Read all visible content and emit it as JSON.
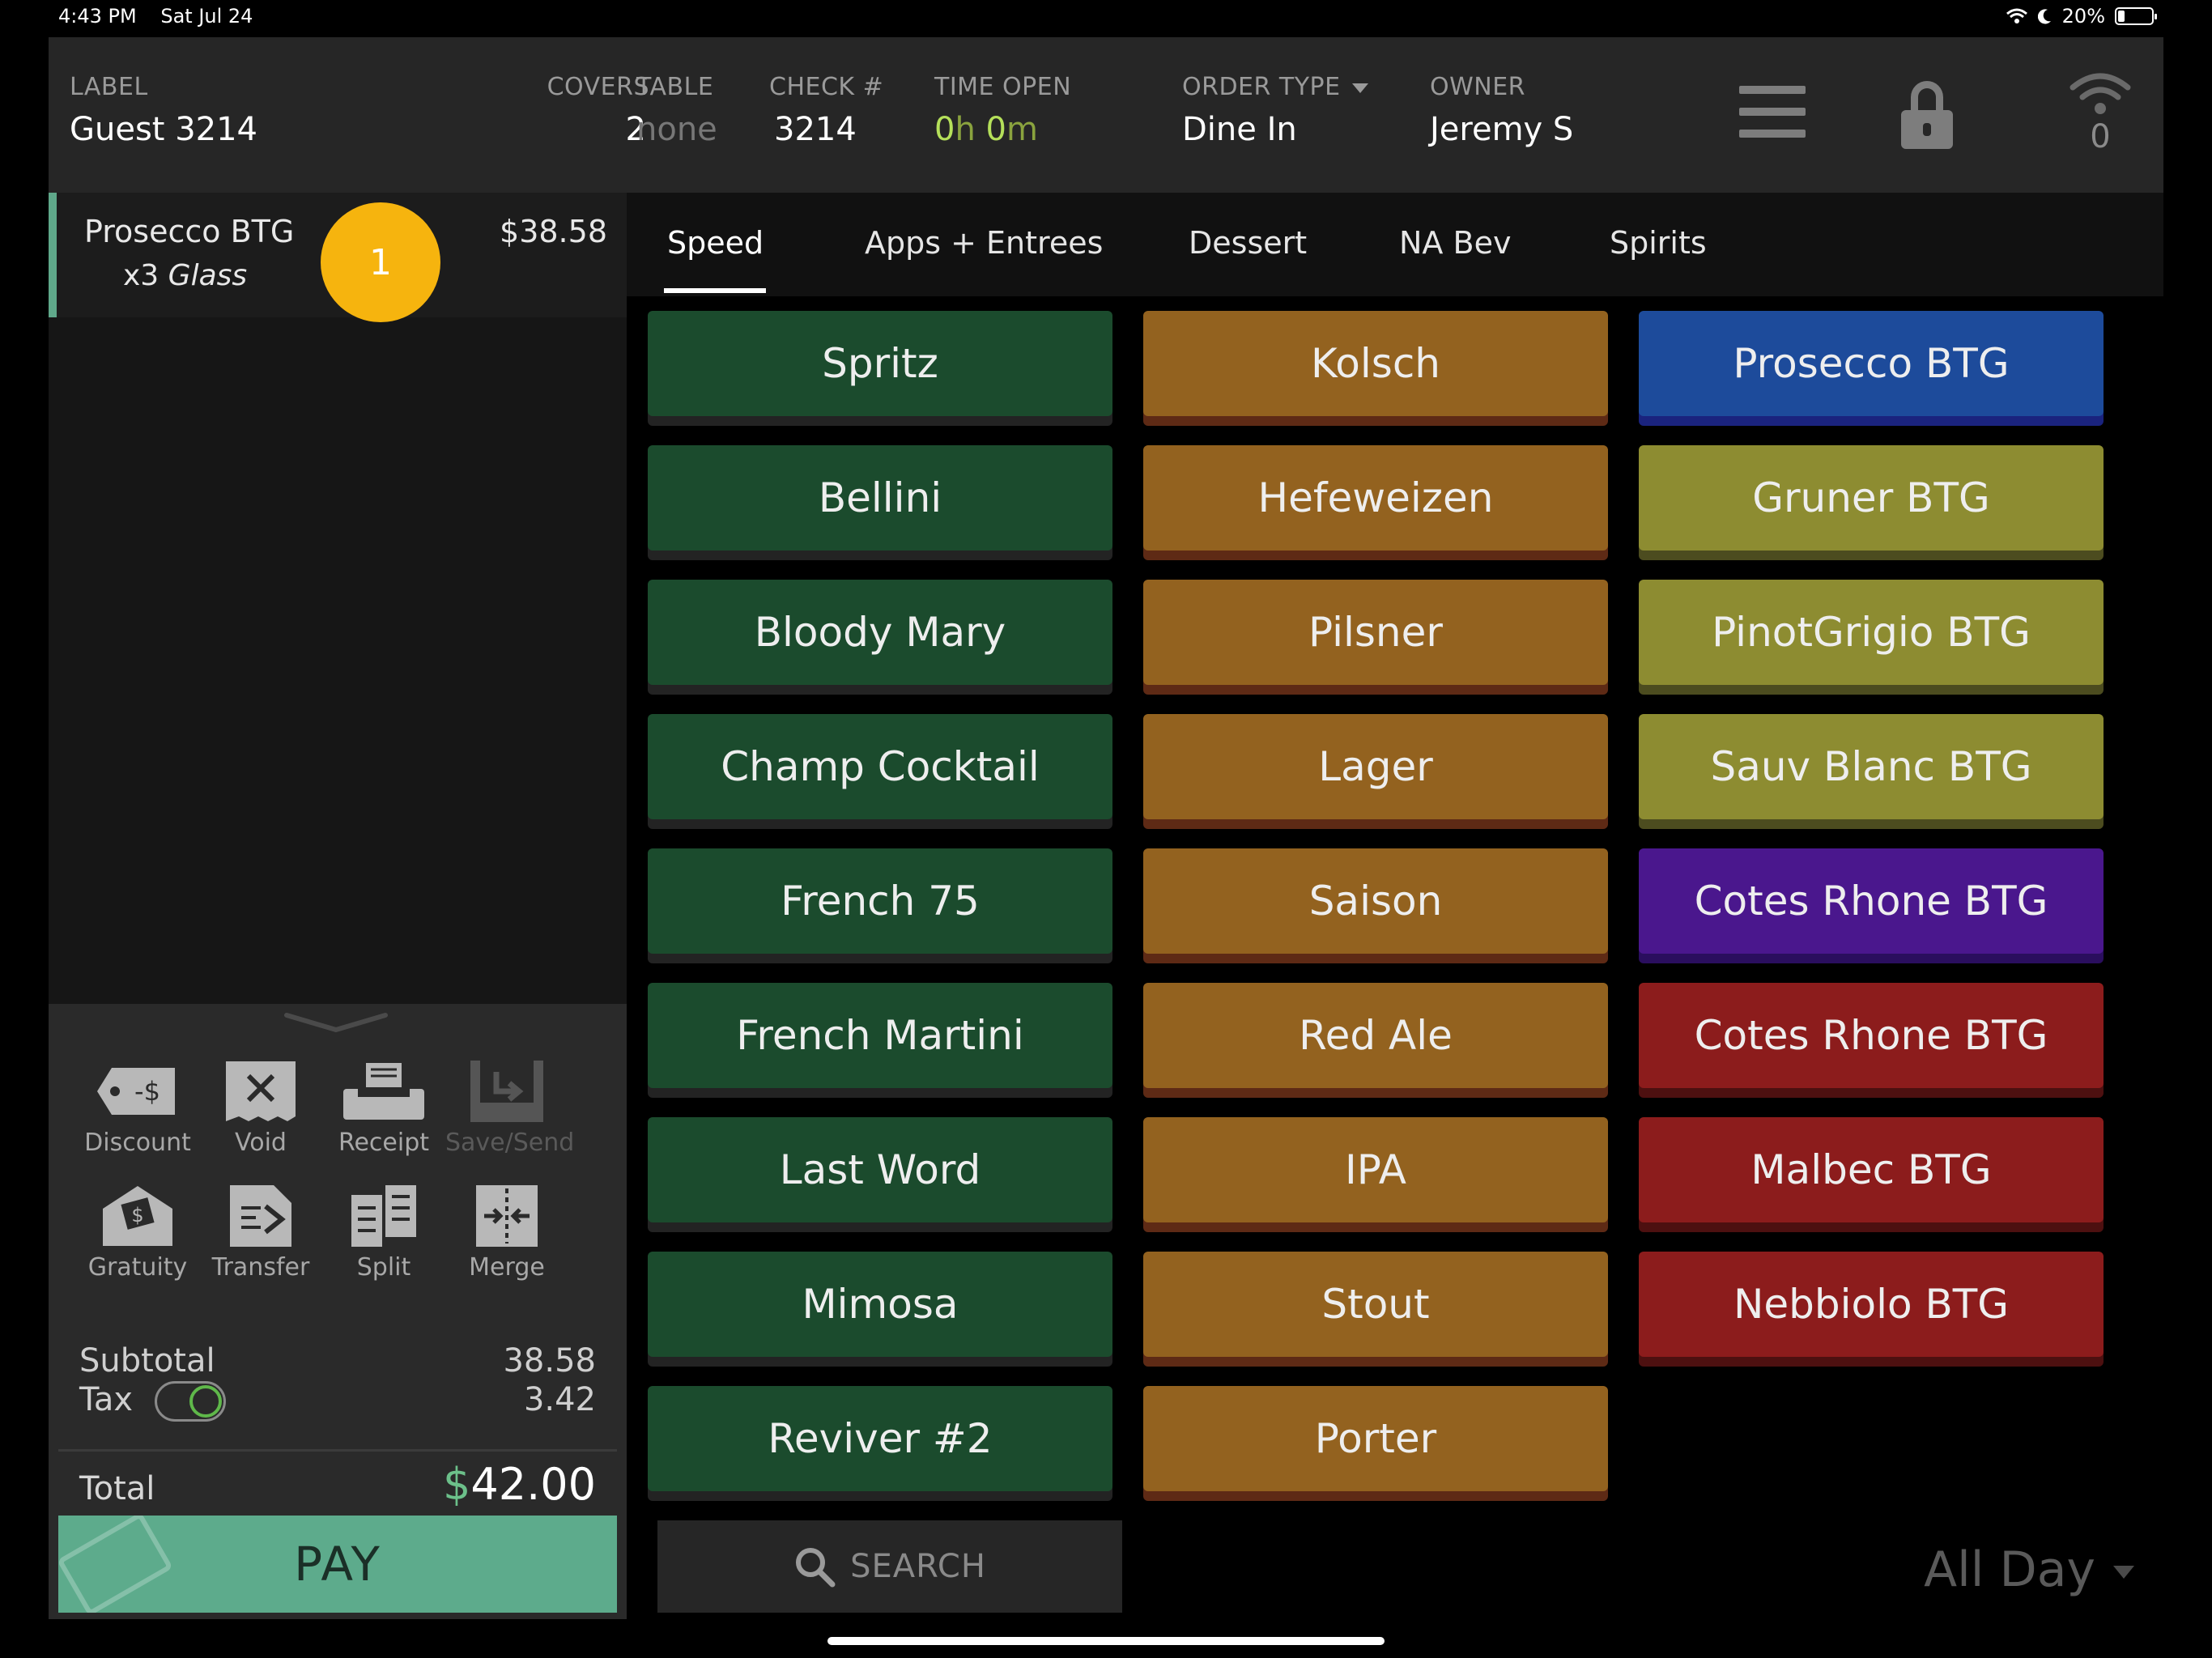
{
  "status_bar": {
    "time": "4:43 PM",
    "date": "Sat Jul 24",
    "battery": "20%"
  },
  "header": {
    "label": {
      "title": "LABEL",
      "value": "Guest 3214"
    },
    "covers": {
      "title": "COVERS",
      "value": "2"
    },
    "table": {
      "title": "TABLE",
      "value": "none"
    },
    "check": {
      "title": "CHECK #",
      "value": "3214"
    },
    "time_open": {
      "title": "TIME OPEN",
      "h": "0",
      "h_unit": "h",
      "m": "0",
      "m_unit": "m"
    },
    "order_type": {
      "title": "ORDER TYPE",
      "value": "Dine In"
    },
    "owner": {
      "title": "OWNER",
      "value": "Jeremy S"
    },
    "wifi_count": "0"
  },
  "order": {
    "item_name": "Prosecco BTG",
    "qty": "x3",
    "modifier": "Glass",
    "seat_badge": "1",
    "price": "$38.58"
  },
  "actions": {
    "discount": "Discount",
    "void": "Void",
    "receipt": "Receipt",
    "save_send": "Save/Send",
    "gratuity": "Gratuity",
    "transfer": "Transfer",
    "split": "Split",
    "merge": "Merge"
  },
  "totals": {
    "subtotal_label": "Subtotal",
    "subtotal": "38.58",
    "tax_label": "Tax",
    "tax": "3.42",
    "total_label": "Total",
    "total_currency": "$",
    "total": "42.00",
    "pay_label": "PAY"
  },
  "tabs": [
    "Speed",
    "Apps + Entrees",
    "Dessert",
    "NA Bev",
    "Spirits"
  ],
  "menu": {
    "col1": [
      "Spritz",
      "Bellini",
      "Bloody Mary",
      "Champ Cocktail",
      "French 75",
      "French Martini",
      "Last Word",
      "Mimosa",
      "Reviver #2"
    ],
    "col2": [
      "Kolsch",
      "Hefeweizen",
      "Pilsner",
      "Lager",
      "Saison",
      "Red Ale",
      "IPA",
      "Stout",
      "Porter"
    ],
    "col3": [
      "Prosecco BTG",
      "Gruner BTG",
      "PinotGrigio BTG",
      "Sauv Blanc BTG",
      "Cotes Rhone BTG",
      "Cotes Rhone BTG",
      "Malbec BTG",
      "Nebbiolo BTG"
    ]
  },
  "colors": {
    "cocktail": "#1b4b2d",
    "beer": "#93621f",
    "sparkling": "#1d4b9b",
    "white_wine": "#8d8c31",
    "rose": "#4a178d",
    "red_wine": "#8c1c1c",
    "pay": "#5dab8c",
    "badge": "#f6b40e"
  },
  "search": {
    "placeholder": "SEARCH"
  },
  "menu_period": "All Day"
}
